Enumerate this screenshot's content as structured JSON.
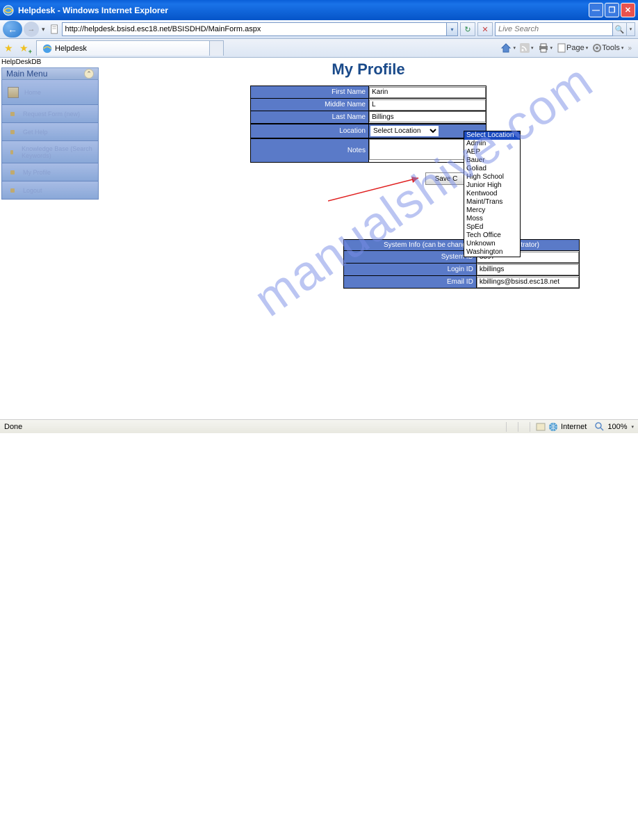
{
  "window": {
    "title": "Helpdesk - Windows Internet Explorer"
  },
  "nav": {
    "url": "http://helpdesk.bsisd.esc18.net/BSISDHD/MainForm.aspx",
    "search_placeholder": "Live Search"
  },
  "tab": {
    "title": "Helpdesk"
  },
  "toolbar": {
    "page": "Page",
    "tools": "Tools"
  },
  "db_label": "HelpDeskDB",
  "sidebar": {
    "header": "Main Menu",
    "items": [
      {
        "label": "Home"
      },
      {
        "label": "Request Form (new)"
      },
      {
        "label": "Get Help"
      },
      {
        "label": "Knowledge Base (Search Keywords)"
      },
      {
        "label": "My Profile"
      },
      {
        "label": "Logout"
      }
    ]
  },
  "page": {
    "title": "My Profile"
  },
  "form": {
    "first_name_label": "First Name",
    "first_name": "Karin",
    "middle_name_label": "Middle Name",
    "middle_name": "L",
    "last_name_label": "Last Name",
    "last_name": "Billings",
    "location_label": "Location",
    "location_selected": "Select Location",
    "notes_label": "Notes",
    "notes": "",
    "save_label": "Save C"
  },
  "location_options": [
    "Select Location",
    "Admin",
    "AEP",
    "Bauer",
    "Goliad",
    "High School",
    "Junior High",
    "Kentwood",
    "Maint/Trans",
    "Mercy",
    "Moss",
    "SpEd",
    "Tech Office",
    "Unknown",
    "Washington"
  ],
  "system_info": {
    "header": "System Info (can be change",
    "header2": "nistrator)",
    "system_id_label": "System ID",
    "system_id": "3397",
    "login_id_label": "Login ID",
    "login_id": "kbillings",
    "email_id_label": "Email ID",
    "email_id": "kbillings@bsisd.esc18.net"
  },
  "status": {
    "done": "Done",
    "zone": "Internet",
    "zoom": "100%"
  },
  "watermark": "manualshive.com"
}
